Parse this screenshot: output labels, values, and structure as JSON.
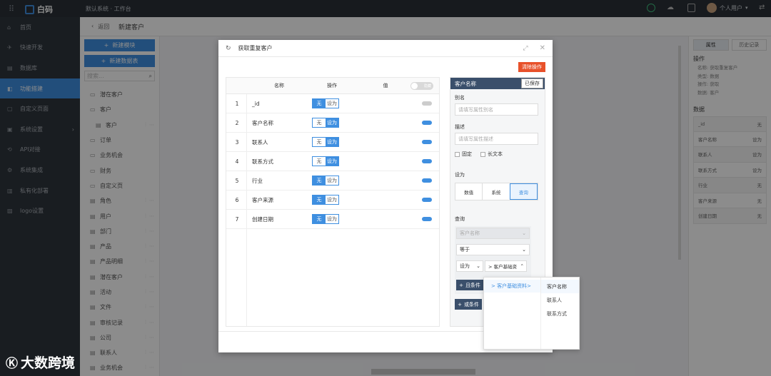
{
  "app": {
    "logo_text": "白码",
    "crumb": "默认系统 · 工作台",
    "user": "个人用户"
  },
  "sidebar": {
    "items": [
      {
        "label": "首页",
        "icon": "home-icon",
        "active": false
      },
      {
        "label": "快速开发",
        "icon": "rocket-icon",
        "active": false
      },
      {
        "label": "数据库",
        "icon": "database-icon",
        "active": false
      },
      {
        "label": "功能搭建",
        "icon": "build-icon",
        "active": true
      },
      {
        "label": "自定义页面",
        "icon": "page-icon",
        "active": false
      },
      {
        "label": "系统设置",
        "icon": "settings-icon",
        "active": false,
        "arrow": "›"
      },
      {
        "label": "API对接",
        "icon": "api-icon",
        "active": false
      },
      {
        "label": "系统集成",
        "icon": "integration-icon",
        "active": false
      },
      {
        "label": "私有化部署",
        "icon": "server-icon",
        "active": false
      },
      {
        "label": "logo设置",
        "icon": "image-icon",
        "active": false
      }
    ]
  },
  "subbar": {
    "back": "返回",
    "title": "新建客户"
  },
  "tree": {
    "new_module": "新建模块",
    "new_table": "新建数据表",
    "search_placeholder": "搜索...",
    "items": [
      {
        "label": "潜在客户",
        "type": "folder"
      },
      {
        "label": "客户",
        "type": "folder-open"
      },
      {
        "label": "客户",
        "type": "doc",
        "sub": true
      },
      {
        "label": "订单",
        "type": "folder"
      },
      {
        "label": "业务机会",
        "type": "folder"
      },
      {
        "label": "财务",
        "type": "folder"
      },
      {
        "label": "自定义页",
        "type": "folder"
      },
      {
        "label": "角色",
        "type": "doc"
      },
      {
        "label": "用户",
        "type": "doc"
      },
      {
        "label": "部门",
        "type": "doc"
      },
      {
        "label": "产品",
        "type": "doc"
      },
      {
        "label": "产品明细",
        "type": "doc"
      },
      {
        "label": "潜在客户",
        "type": "doc"
      },
      {
        "label": "活动",
        "type": "doc"
      },
      {
        "label": "文件",
        "type": "doc"
      },
      {
        "label": "审核记录",
        "type": "doc"
      },
      {
        "label": "公司",
        "type": "doc"
      },
      {
        "label": "联系人",
        "type": "doc"
      },
      {
        "label": "业务机会",
        "type": "doc"
      }
    ]
  },
  "right": {
    "tabs": [
      "属性",
      "历史记录"
    ],
    "section_op": "操作",
    "op_lines": [
      "名称: 获取重复客户",
      "类型: 数据",
      "操作: 获取",
      "数据: 客户"
    ],
    "section_data": "数据",
    "rows": [
      [
        "_id",
        "无"
      ],
      [
        "客户名称",
        "设为"
      ],
      [
        "联系人",
        "设为"
      ],
      [
        "联系方式",
        "设为"
      ],
      [
        "行业",
        "无"
      ],
      [
        "客户来源",
        "无"
      ],
      [
        "创建日期",
        "无"
      ]
    ]
  },
  "modal": {
    "title": "获取重复客户",
    "clear_btn": "清除操作",
    "head": {
      "name": "名称",
      "op": "操作",
      "value": "值",
      "toggle": "隐藏"
    },
    "rows": [
      {
        "n": "1",
        "name": "_id",
        "sel": "无",
        "on": false
      },
      {
        "n": "2",
        "name": "客户名称",
        "sel": "设为",
        "on": true
      },
      {
        "n": "3",
        "name": "联系人",
        "sel": "设为",
        "on": true
      },
      {
        "n": "4",
        "name": "联系方式",
        "sel": "设为",
        "on": true
      },
      {
        "n": "5",
        "name": "行业",
        "sel": "无",
        "on": true
      },
      {
        "n": "6",
        "name": "客户来源",
        "sel": "无",
        "on": true
      },
      {
        "n": "7",
        "name": "创建日期",
        "sel": "无",
        "on": true
      }
    ],
    "seg_none": "无",
    "seg_set": "设为"
  },
  "prop": {
    "title": "客户名称",
    "saved": "已保存",
    "alias_label": "别名",
    "alias_ph": "请填写属性别名",
    "desc_label": "描述",
    "desc_ph": "请填写属性描述",
    "fixed": "固定",
    "longtext": "长文本",
    "setas_label": "设为",
    "setas_opts": [
      "数值",
      "系统",
      "查询"
    ],
    "query_label": "查询",
    "q_field": "客户名称",
    "q_op": "等于",
    "q_setas": "设为",
    "q_target": "> 客户基础资",
    "and_btn": "且条件",
    "or_btn": "或条件"
  },
  "dropdown": {
    "left_item": "> 客户基础资料>",
    "right_items": [
      "客户名称",
      "联系人",
      "联系方式"
    ]
  },
  "watermark": {
    "text": "大数跨境"
  }
}
